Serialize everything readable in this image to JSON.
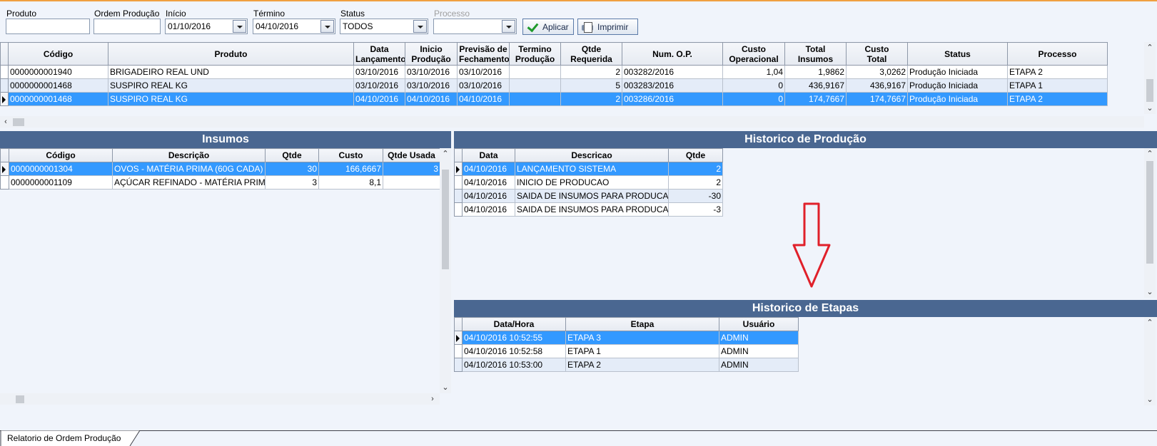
{
  "filters": {
    "produto": {
      "label": "Produto",
      "value": ""
    },
    "ordem": {
      "label": "Ordem Produção",
      "value": ""
    },
    "inicio": {
      "label": "Início",
      "value": "01/10/2016"
    },
    "termino": {
      "label": "Término",
      "value": "04/10/2016"
    },
    "status": {
      "label": "Status",
      "value": "TODOS"
    },
    "processo": {
      "label": "Processo",
      "value": ""
    },
    "apply_label": "Aplicar",
    "print_label": "Imprimir"
  },
  "orders": {
    "headers": [
      {
        "l1": "Código",
        "l2": ""
      },
      {
        "l1": "Produto",
        "l2": ""
      },
      {
        "l1": "Data",
        "l2": "Lançamento"
      },
      {
        "l1": "Inicio",
        "l2": "Produção"
      },
      {
        "l1": "Previsão de",
        "l2": "Fechamento"
      },
      {
        "l1": "Termino",
        "l2": "Produção"
      },
      {
        "l1": "Qtde",
        "l2": "Requerida"
      },
      {
        "l1": "Num. O.P.",
        "l2": ""
      },
      {
        "l1": "Custo",
        "l2": "Operacional"
      },
      {
        "l1": "Total",
        "l2": "Insumos"
      },
      {
        "l1": "Custo",
        "l2": "Total"
      },
      {
        "l1": "Status",
        "l2": ""
      },
      {
        "l1": "Processo",
        "l2": ""
      }
    ],
    "rows": [
      [
        "0000000001940",
        "BRIGADEIRO REAL UND",
        "03/10/2016",
        "03/10/2016",
        "03/10/2016",
        "",
        "2",
        "003282/2016",
        "1,04",
        "1,9862",
        "3,0262",
        "Produção Iniciada",
        "ETAPA 2"
      ],
      [
        "0000000001468",
        "SUSPIRO REAL KG",
        "03/10/2016",
        "03/10/2016",
        "03/10/2016",
        "",
        "5",
        "003283/2016",
        "0",
        "436,9167",
        "436,9167",
        "Produção Iniciada",
        "ETAPA 1"
      ],
      [
        "0000000001468",
        "SUSPIRO REAL KG",
        "04/10/2016",
        "04/10/2016",
        "04/10/2016",
        "",
        "2",
        "003286/2016",
        "0",
        "174,7667",
        "174,7667",
        "Produção Iniciada",
        "ETAPA 2"
      ]
    ],
    "selected_row": 2
  },
  "insumos": {
    "title": "Insumos",
    "headers": [
      "Código",
      "Descrição",
      "Qtde",
      "Custo",
      "Qtde Usada"
    ],
    "rows": [
      [
        "0000000001304",
        "OVOS - MATÉRIA PRIMA (60G CADA)",
        "30",
        "166,6667",
        "3"
      ],
      [
        "0000000001109",
        "AÇÚCAR REFINADO - MATÉRIA PRIMA",
        "3",
        "8,1",
        ""
      ]
    ]
  },
  "historico_producao": {
    "title": "Historico de Produção",
    "headers": [
      "Data",
      "Descricao",
      "Qtde"
    ],
    "rows": [
      [
        "04/10/2016",
        "LANÇAMENTO SISTEMA",
        "2"
      ],
      [
        "04/10/2016",
        "INICIO DE PRODUCAO",
        "2"
      ],
      [
        "04/10/2016",
        "SAIDA DE INSUMOS PARA PRODUCAO",
        "-30"
      ],
      [
        "04/10/2016",
        "SAIDA DE INSUMOS PARA PRODUCAO",
        "-3"
      ]
    ]
  },
  "historico_etapas": {
    "title": "Historico de Etapas",
    "headers": [
      "Data/Hora",
      "Etapa",
      "Usuário"
    ],
    "rows": [
      [
        "04/10/2016 10:52:55",
        "ETAPA 3",
        "ADMIN"
      ],
      [
        "04/10/2016 10:52:58",
        "ETAPA 1",
        "ADMIN"
      ],
      [
        "04/10/2016 10:53:00",
        "ETAPA 2",
        "ADMIN"
      ]
    ]
  },
  "tab_label": "Relatorio de Ordem Produção",
  "colors": {
    "selection": "#3399ff",
    "panel_title": "#4a6791",
    "annotation_arrow": "#e0202a"
  },
  "icons": {
    "apply": "check-icon",
    "print": "printer-icon",
    "row_indicator": "arrow-right-icon",
    "annotation": "down-arrow-icon"
  }
}
